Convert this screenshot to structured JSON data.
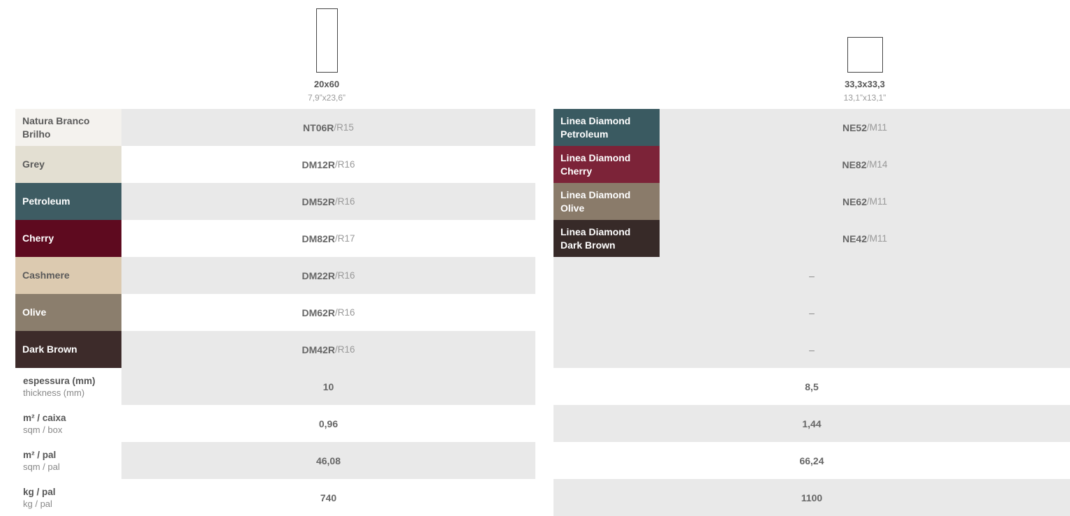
{
  "left": {
    "format": {
      "size": "20x60",
      "inch": "7,9”x23,6”"
    },
    "products": [
      {
        "name": "Natura Branco Brilho",
        "color": "#f4f2ee",
        "light": true,
        "code": "NT06R",
        "sep": " / ",
        "rating": "R15"
      },
      {
        "name": "Grey",
        "color": "#e3dfd2",
        "light": true,
        "code": "DM12R",
        "sep": " / ",
        "rating": "R16"
      },
      {
        "name": "Petroleum",
        "color": "#3e5c63",
        "light": false,
        "code": "DM52R",
        "sep": " / ",
        "rating": "R16"
      },
      {
        "name": "Cherry",
        "color": "#5e0a1f",
        "light": false,
        "code": "DM82R",
        "sep": " / ",
        "rating": "R17"
      },
      {
        "name": "Cashmere",
        "color": "#dccab0",
        "light": true,
        "code": "DM22R",
        "sep": " / ",
        "rating": "R16"
      },
      {
        "name": "Olive",
        "color": "#8b7e6d",
        "light": false,
        "code": "DM62R",
        "sep": " / ",
        "rating": "R16"
      },
      {
        "name": "Dark Brown",
        "color": "#3d2b2a",
        "light": false,
        "code": "DM42R",
        "sep": " / ",
        "rating": "R16"
      }
    ],
    "specs": [
      {
        "main": "espessura (mm)",
        "sub": "thickness (mm)",
        "value": "10"
      },
      {
        "main": "m² / caixa",
        "sub": "sqm / box",
        "value": "0,96"
      },
      {
        "main": "m² / pal",
        "sub": "sqm / pal",
        "value": "46,08"
      },
      {
        "main": "kg / pal",
        "sub": "kg / pal",
        "value": "740"
      }
    ]
  },
  "right": {
    "format": {
      "size": "33,3x33,3",
      "inch": "13,1”x13,1”"
    },
    "products": [
      {
        "name_line1": "Linea Diamond",
        "name_line2": "Petroleum",
        "color": "#3a5a61",
        "code": "NE52",
        "sep": " / ",
        "rating": "M11"
      },
      {
        "name_line1": "Linea Diamond",
        "name_line2": "Cherry",
        "color": "#7c2338",
        "code": "NE82",
        "sep": " / ",
        "rating": "M14"
      },
      {
        "name_line1": "Linea Diamond",
        "name_line2": "Olive",
        "color": "#8a7b6a",
        "code": "NE62",
        "sep": " / ",
        "rating": "M11"
      },
      {
        "name_line1": "Linea Diamond",
        "name_line2": "Dark Brown",
        "color": "#372a28",
        "code": "NE42",
        "sep": " / ",
        "rating": "M11"
      }
    ],
    "empty_rows": [
      "–",
      "–",
      "–"
    ],
    "specs": [
      "8,5",
      "1,44",
      "66,24",
      "1100"
    ]
  }
}
